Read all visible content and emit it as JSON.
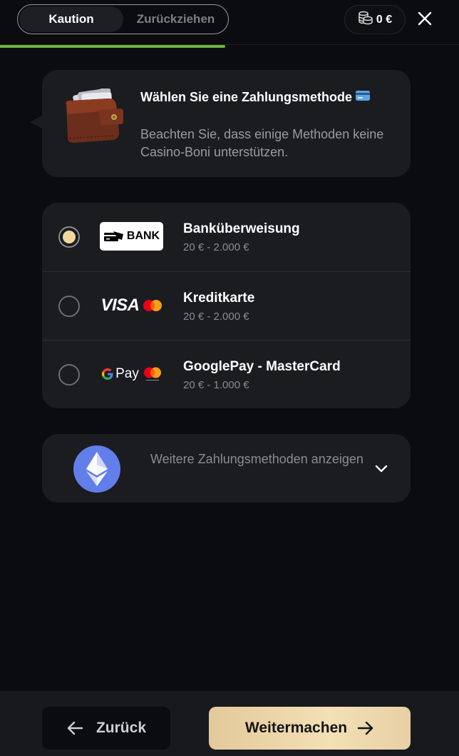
{
  "header": {
    "tabs": [
      {
        "label": "Kaution",
        "active": true
      },
      {
        "label": "Zurückziehen",
        "active": false
      }
    ],
    "balance": "0 €",
    "progress_fraction": 0.49
  },
  "info": {
    "title": "Wählen Sie eine Zahlungsmethode",
    "subtitle": "Beachten Sie, dass einige Methoden keine Casino-Boni unterstützen."
  },
  "methods": [
    {
      "name": "Banküberweisung",
      "range": "20 € - 2.000 €",
      "logo_text": "BANK",
      "selected": true
    },
    {
      "name": "Kreditkarte",
      "range": "20 € - 2.000 €",
      "logo_text": "VISA",
      "selected": false
    },
    {
      "name": "GooglePay - MasterCard",
      "range": "20 € - 1.000 €",
      "logo_text": "Pay",
      "selected": false
    }
  ],
  "more": {
    "label": "Weitere Zahlungsmethoden anzeigen"
  },
  "footer": {
    "back_label": "Zurück",
    "next_label": "Weitermachen"
  },
  "colors": {
    "background": "#0b0c0f",
    "card": "#1b1c20",
    "accent_gold": "#f0d79b",
    "progress_green": "#6fb540",
    "ethereum": "#627eea"
  }
}
